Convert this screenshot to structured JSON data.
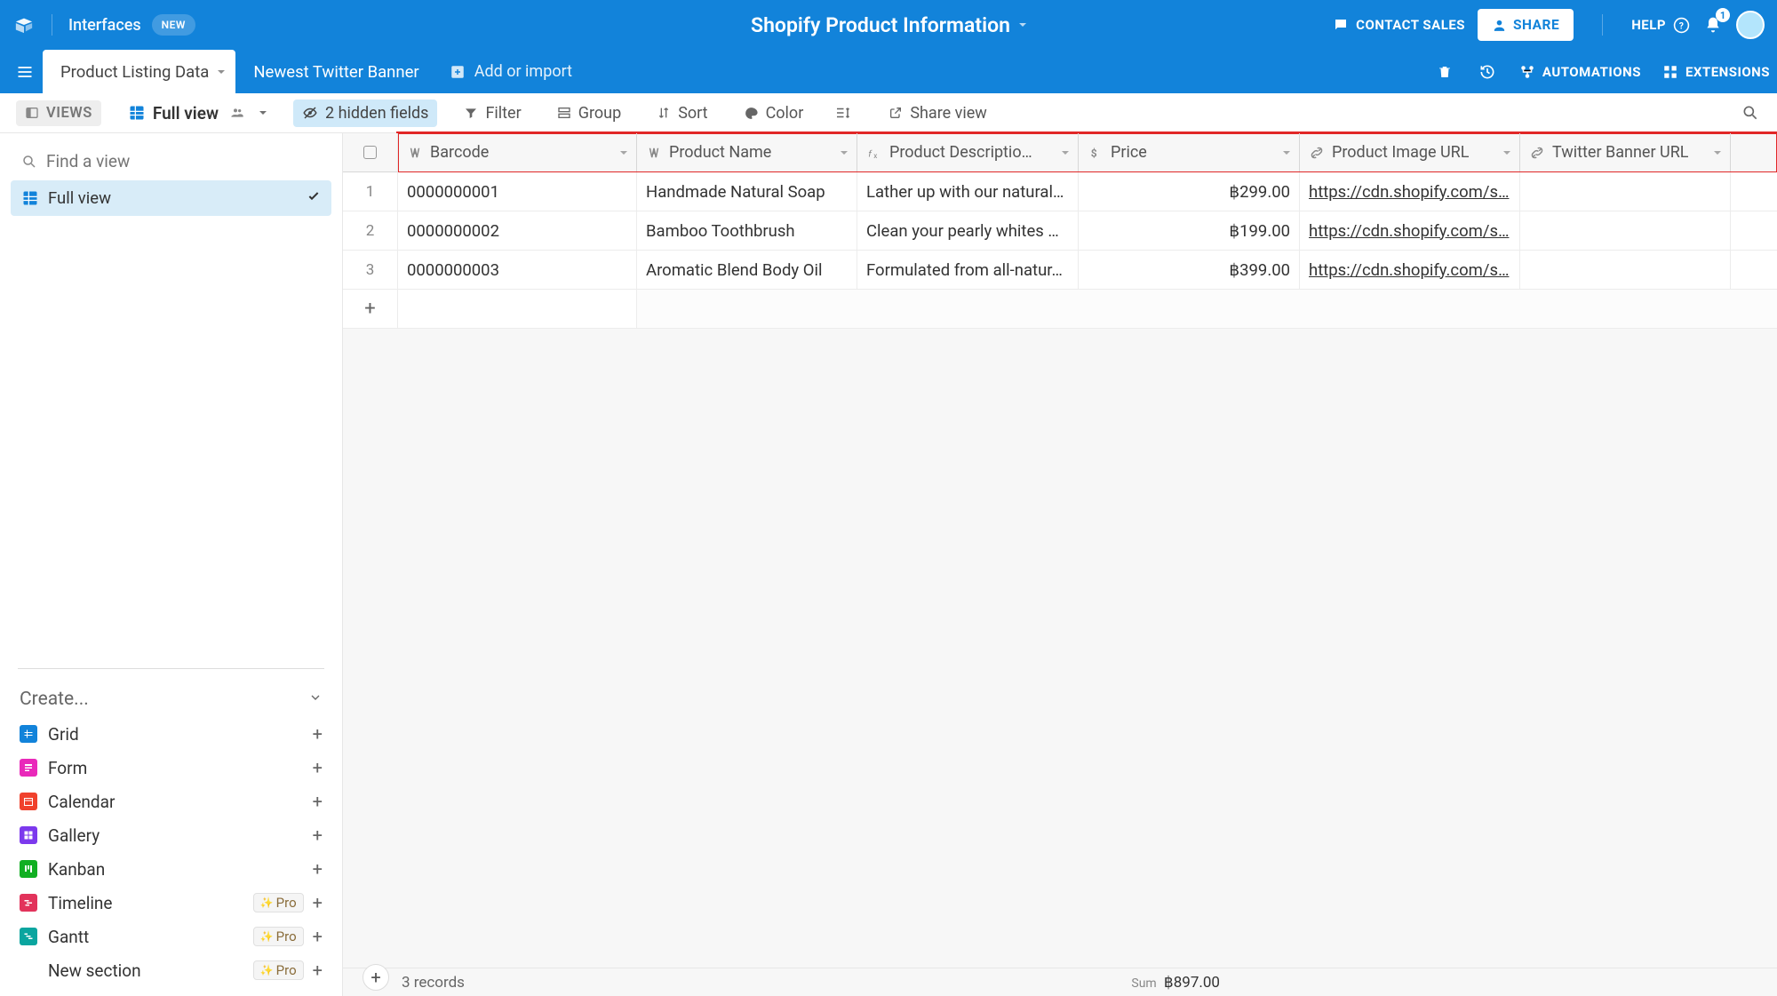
{
  "top": {
    "interfaces": "Interfaces",
    "new_badge": "NEW",
    "base_name": "Shopify Product Information",
    "contact": "CONTACT SALES",
    "share": "SHARE",
    "help": "HELP",
    "notif_count": "1",
    "automations": "AUTOMATIONS",
    "extensions": "EXTENSIONS"
  },
  "tabs": {
    "t0": "Product Listing Data",
    "t1": "Newest Twitter Banner",
    "add": "Add or import"
  },
  "toolbar": {
    "views": "VIEWS",
    "viewname": "Full view",
    "hidden": "2 hidden fields",
    "filter": "Filter",
    "group": "Group",
    "sort": "Sort",
    "color": "Color",
    "share": "Share view"
  },
  "sidebar": {
    "find_placeholder": "Find a view",
    "view": "Full view",
    "create": "Create...",
    "grid": "Grid",
    "form": "Form",
    "calendar": "Calendar",
    "gallery": "Gallery",
    "kanban": "Kanban",
    "timeline": "Timeline",
    "gantt": "Gantt",
    "newsection": "New section",
    "pro": "Pro"
  },
  "cols": {
    "c0": "Barcode",
    "c1": "Product Name",
    "c2": "Product Descriptio…",
    "c3": "Price",
    "c4": "Product Image URL",
    "c5": "Twitter Banner URL"
  },
  "widths": {
    "rownum": 62,
    "c0": 269,
    "c1": 248,
    "c2": 249,
    "c3": 249,
    "c4": 248,
    "c5": 237
  },
  "rows": [
    {
      "n": "1",
      "barcode": "0000000001",
      "name": "Handmade Natural Soap",
      "desc": "Lather up with our natural…",
      "price": "฿299.00",
      "url": "https://cdn.shopify.com/s…",
      "tw": ""
    },
    {
      "n": "2",
      "barcode": "0000000002",
      "name": "Bamboo Toothbrush",
      "desc": "Clean your pearly whites …",
      "price": "฿199.00",
      "url": "https://cdn.shopify.com/s…",
      "tw": ""
    },
    {
      "n": "3",
      "barcode": "0000000003",
      "name": "Aromatic Blend Body Oil",
      "desc": "Formulated from all-natur…",
      "price": "฿399.00",
      "url": "https://cdn.shopify.com/s…",
      "tw": ""
    }
  ],
  "status": {
    "records": "3 records",
    "sum_label": "Sum",
    "sum_value": "฿897.00"
  }
}
